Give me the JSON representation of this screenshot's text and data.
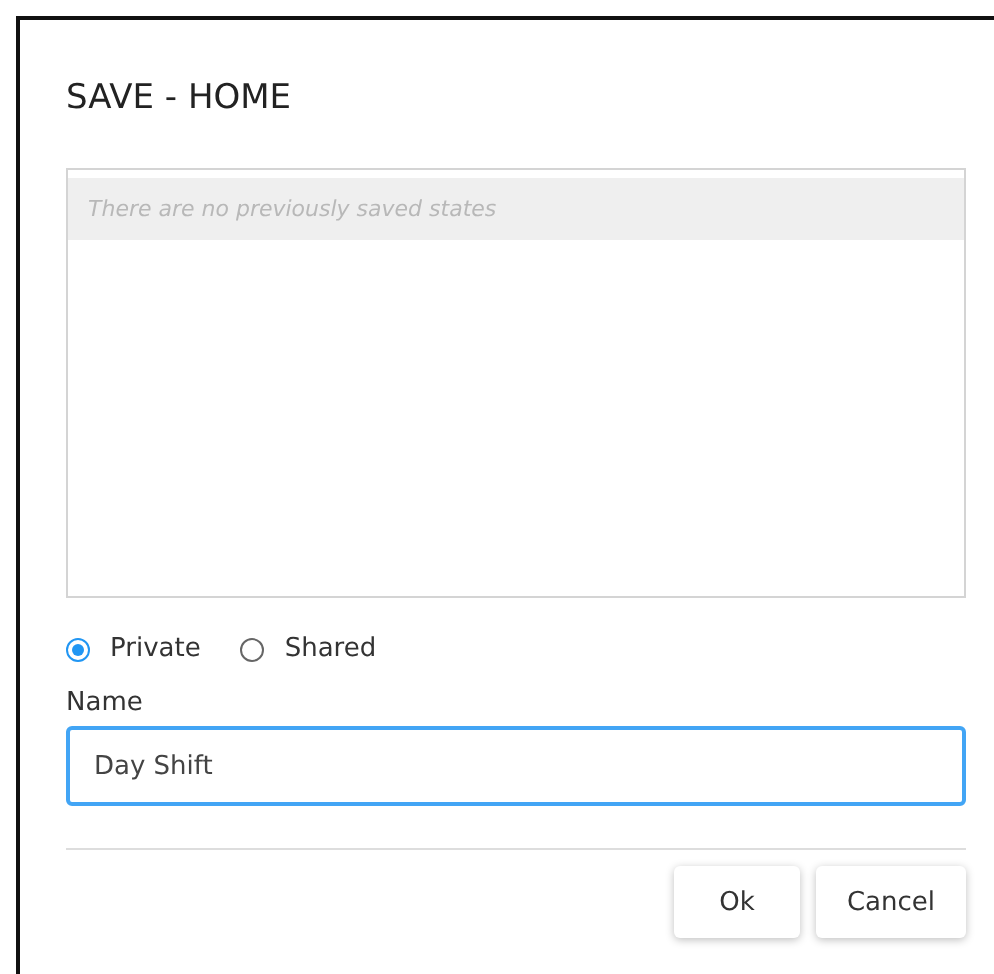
{
  "dialog": {
    "title": "SAVE - HOME"
  },
  "saved_states": {
    "empty_message": "There are no previously saved states"
  },
  "visibility": [
    {
      "label": "Private",
      "selected": true
    },
    {
      "label": "Shared",
      "selected": false
    }
  ],
  "name_field": {
    "label": "Name",
    "value": "Day Shift"
  },
  "buttons": [
    "Ok",
    "Cancel"
  ]
}
